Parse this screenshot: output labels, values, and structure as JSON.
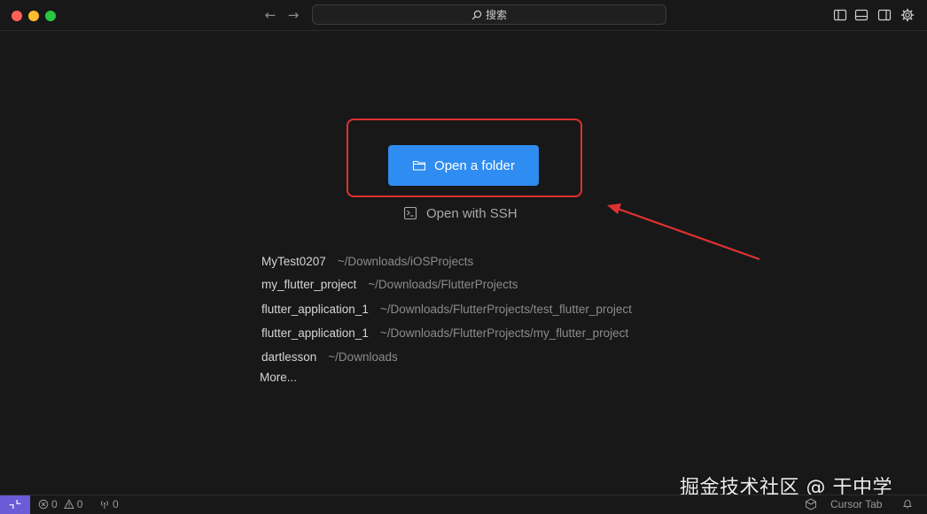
{
  "titlebar": {
    "search_label": "搜索",
    "nav_back_icon": "arrow-left-icon",
    "nav_forward_icon": "arrow-right-icon",
    "layout_icons": [
      "toggle-primary-sidebar-icon",
      "toggle-panel-icon",
      "toggle-secondary-sidebar-icon",
      "settings-gear-icon"
    ]
  },
  "welcome": {
    "open_folder_label": "Open a folder",
    "open_ssh_label": "Open with SSH",
    "recent_projects": [
      {
        "name": "MyTest0207",
        "path": "~/Downloads/iOSProjects"
      },
      {
        "name": "my_flutter_project",
        "path": "~/Downloads/FlutterProjects"
      },
      {
        "name": "flutter_application_1",
        "path": "~/Downloads/FlutterProjects/test_flutter_project"
      },
      {
        "name": "flutter_application_1",
        "path": "~/Downloads/FlutterProjects/my_flutter_project"
      },
      {
        "name": "dartlesson",
        "path": "~/Downloads"
      }
    ],
    "more_label": "More..."
  },
  "statusbar": {
    "errors_count": "0",
    "warnings_count": "0",
    "ports_count": "0",
    "cursor_tab_label": "Cursor Tab"
  },
  "watermark": {
    "text": "掘金技术社区 @ 干中学"
  },
  "colors": {
    "accent_button": "#2f8cf0",
    "annotation_red": "#e03131",
    "remote_indicator": "#6b5bd6",
    "background": "#181818"
  }
}
